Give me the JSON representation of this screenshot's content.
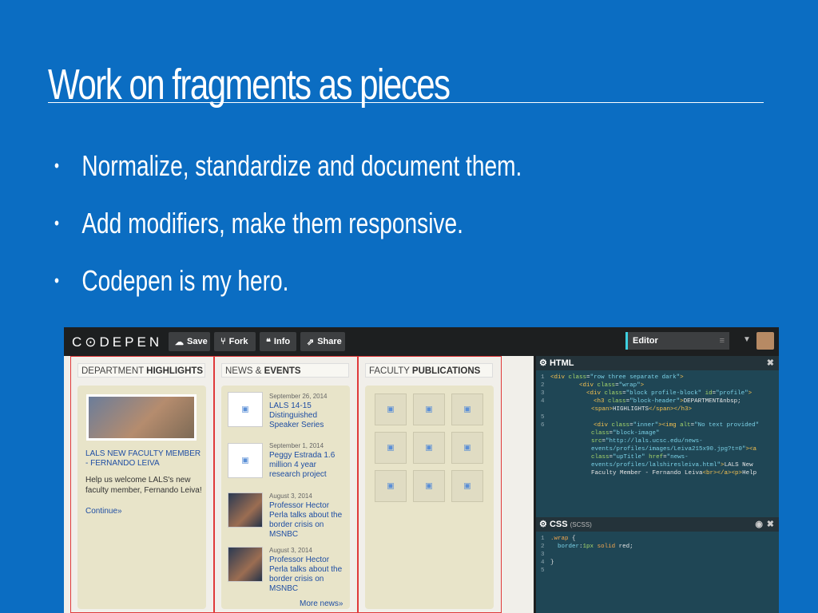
{
  "slide": {
    "title": "Work on fragments as pieces",
    "bullets": [
      "Normalize, standardize and document them.",
      "Add modifiers, make them responsive.",
      "Codepen is my hero."
    ],
    "bullet_glyph": "•"
  },
  "codepen": {
    "logo": "C⊙DEPEN",
    "toolbar": {
      "save": "Save",
      "fork": "Fork",
      "info": "Info",
      "share": "Share",
      "editor": "Editor"
    },
    "preview": {
      "dept": {
        "head_pre": "DEPARTMENT ",
        "head_bold": "HIGHLIGHTS",
        "title": "LALS NEW FACULTY MEMBER - FERNANDO LEIVA",
        "body": "Help us welcome LALS's new faculty member, Fernando Leiva!",
        "link": "Continue»"
      },
      "news": {
        "head_pre": "NEWS & ",
        "head_bold": "EVENTS",
        "items": [
          {
            "date": "September 26, 2014",
            "title": "LALS 14-15 Distinguished Speaker Series"
          },
          {
            "date": "September 1, 2014",
            "title": "Peggy Estrada 1.6 million 4 year research project"
          },
          {
            "date": "August 3, 2014",
            "title": "Professor Hector Perla talks about the border crisis on MSNBC"
          },
          {
            "date": "August 3, 2014",
            "title": "Professor Hector Perla talks about the border crisis on MSNBC"
          }
        ],
        "more": "More news»"
      },
      "faculty": {
        "head_pre": "FACULTY ",
        "head_bold": "PUBLICATIONS"
      }
    },
    "html_panel": {
      "label": "HTML"
    },
    "css_panel": {
      "label": "CSS",
      "sub": "(SCSS)"
    }
  }
}
